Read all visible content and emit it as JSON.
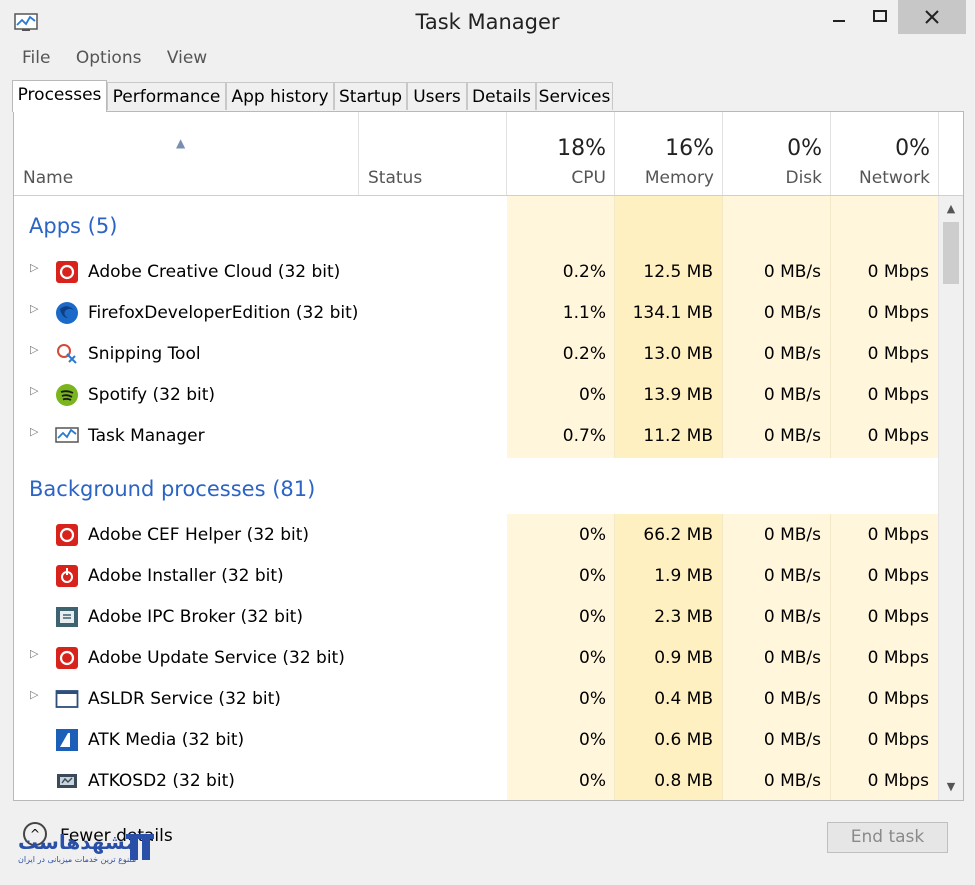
{
  "window": {
    "title": "Task Manager"
  },
  "menu": [
    "File",
    "Options",
    "View"
  ],
  "tabs": [
    "Processes",
    "Performance",
    "App history",
    "Startup",
    "Users",
    "Details",
    "Services"
  ],
  "columns": {
    "name": "Name",
    "status": "Status",
    "cpu": {
      "pct": "18%",
      "label": "CPU"
    },
    "memory": {
      "pct": "16%",
      "label": "Memory"
    },
    "disk": {
      "pct": "0%",
      "label": "Disk"
    },
    "network": {
      "pct": "0%",
      "label": "Network"
    }
  },
  "groups": {
    "apps": {
      "label": "Apps (5)",
      "rows": [
        {
          "name": "Adobe Creative Cloud (32 bit)",
          "cpu": "0.2%",
          "memory": "12.5 MB",
          "disk": "0 MB/s",
          "network": "0 Mbps",
          "icon": "adobe-creative-cloud-icon"
        },
        {
          "name": "FirefoxDeveloperEdition (32 bit)",
          "cpu": "1.1%",
          "memory": "134.1 MB",
          "disk": "0 MB/s",
          "network": "0 Mbps",
          "icon": "firefox-icon"
        },
        {
          "name": "Snipping Tool",
          "cpu": "0.2%",
          "memory": "13.0 MB",
          "disk": "0 MB/s",
          "network": "0 Mbps",
          "icon": "snipping-tool-icon"
        },
        {
          "name": "Spotify (32 bit)",
          "cpu": "0%",
          "memory": "13.9 MB",
          "disk": "0 MB/s",
          "network": "0 Mbps",
          "icon": "spotify-icon"
        },
        {
          "name": "Task Manager",
          "cpu": "0.7%",
          "memory": "11.2 MB",
          "disk": "0 MB/s",
          "network": "0 Mbps",
          "icon": "task-manager-icon"
        }
      ]
    },
    "background": {
      "label": "Background processes (81)",
      "rows": [
        {
          "name": "Adobe CEF Helper (32 bit)",
          "cpu": "0%",
          "memory": "66.2 MB",
          "disk": "0 MB/s",
          "network": "0 Mbps",
          "icon": "adobe-cef-icon"
        },
        {
          "name": "Adobe Installer (32 bit)",
          "cpu": "0%",
          "memory": "1.9 MB",
          "disk": "0 MB/s",
          "network": "0 Mbps",
          "icon": "adobe-installer-icon"
        },
        {
          "name": "Adobe IPC Broker (32 bit)",
          "cpu": "0%",
          "memory": "2.3 MB",
          "disk": "0 MB/s",
          "network": "0 Mbps",
          "icon": "adobe-ipc-icon"
        },
        {
          "name": "Adobe Update Service (32 bit)",
          "cpu": "0%",
          "memory": "0.9 MB",
          "disk": "0 MB/s",
          "network": "0 Mbps",
          "icon": "adobe-update-icon"
        },
        {
          "name": "ASLDR Service (32 bit)",
          "cpu": "0%",
          "memory": "0.4 MB",
          "disk": "0 MB/s",
          "network": "0 Mbps",
          "icon": "window-icon"
        },
        {
          "name": "ATK Media (32 bit)",
          "cpu": "0%",
          "memory": "0.6 MB",
          "disk": "0 MB/s",
          "network": "0 Mbps",
          "icon": "atk-media-icon"
        },
        {
          "name": "ATKOSD2 (32 bit)",
          "cpu": "0%",
          "memory": "0.8 MB",
          "disk": "0 MB/s",
          "network": "0 Mbps",
          "icon": "atkosd-icon"
        }
      ]
    }
  },
  "footer": {
    "fewer_details": "Fewer details",
    "end_task": "End task"
  },
  "watermark": {
    "title": "مشهدهاست",
    "subtitle": "متنوع ترین خدمات میزبانی در ایران"
  },
  "colors": {
    "group_blue": "#2b64c5",
    "band_light": "#fff6dc",
    "band_dark": "#fff0c2",
    "close_btn": "#c7c7c7"
  }
}
